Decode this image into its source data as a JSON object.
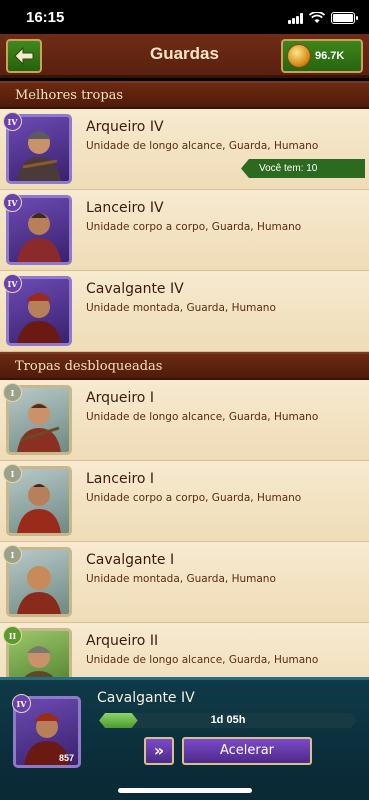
{
  "status_bar": {
    "time": "16:15"
  },
  "header": {
    "title": "Guardas",
    "gold": "96.7K"
  },
  "sections": [
    {
      "title": "Melhores tropas",
      "rows": [
        {
          "name": "Arqueiro IV",
          "desc": "Unidade de longo alcance, Guarda, Humano",
          "tier": "IV",
          "badge": "Você tem: 10"
        },
        {
          "name": "Lanceiro IV",
          "desc": "Unidade corpo a corpo, Guarda, Humano",
          "tier": "IV"
        },
        {
          "name": "Cavalgante IV",
          "desc": "Unidade montada, Guarda, Humano",
          "tier": "IV"
        }
      ]
    },
    {
      "title": "Tropas desbloqueadas",
      "rows": [
        {
          "name": "Arqueiro I",
          "desc": "Unidade de longo alcance, Guarda, Humano",
          "tier": "I"
        },
        {
          "name": "Lanceiro I",
          "desc": "Unidade corpo a corpo, Guarda, Humano",
          "tier": "I"
        },
        {
          "name": "Cavalgante I",
          "desc": "Unidade montada, Guarda, Humano",
          "tier": "I"
        },
        {
          "name": "Arqueiro II",
          "desc": "Unidade de longo alcance, Guarda, Humano",
          "tier": "II"
        }
      ]
    }
  ],
  "queue": {
    "name": "Cavalgante IV",
    "tier": "IV",
    "count": "857",
    "time_left": "1d 05h",
    "progress": 0.15,
    "skip_label": "»",
    "speed_up_label": "Acelerar"
  },
  "colors": {
    "accent_green": "#2c6a20",
    "header_brown": "#5a2010",
    "panel_cream": "#f3e4c5",
    "purple": "#6a3fb0"
  }
}
